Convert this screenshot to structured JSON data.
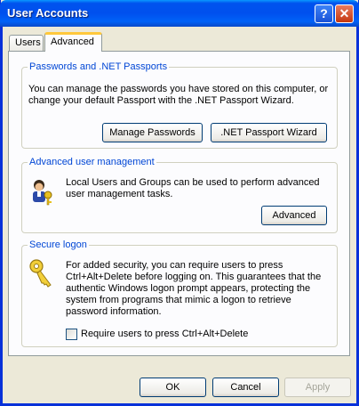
{
  "window": {
    "title": "User Accounts",
    "help_label": "?",
    "close_label": "✕"
  },
  "tabs": [
    {
      "label": "Users",
      "active": false
    },
    {
      "label": "Advanced",
      "active": true
    }
  ],
  "passwords": {
    "legend": "Passwords and .NET Passports",
    "text": "You can manage the passwords you have stored on this computer, or change your default Passport with the .NET Passport Wizard.",
    "manage_button": "Manage Passwords",
    "passport_button": ".NET Passport Wizard"
  },
  "advanced_mgmt": {
    "legend": "Advanced user management",
    "text": "Local Users and Groups can be used to perform advanced user management tasks.",
    "advanced_button": "Advanced",
    "icon": "users-key-icon"
  },
  "secure_logon": {
    "legend": "Secure logon",
    "text": "For added security, you can require users to press Ctrl+Alt+Delete before logging on. This guarantees that the authentic Windows logon prompt appears, protecting the system from programs that mimic a logon to retrieve password information.",
    "checkbox_label": "Require users to press Ctrl+Alt+Delete",
    "checked": false,
    "icon": "key-icon"
  },
  "footer": {
    "ok": "OK",
    "cancel": "Cancel",
    "apply": "Apply"
  },
  "colors": {
    "accent": "#0046d5",
    "titlebar": "#0054e3",
    "tab_highlight": "#ffc83c"
  }
}
